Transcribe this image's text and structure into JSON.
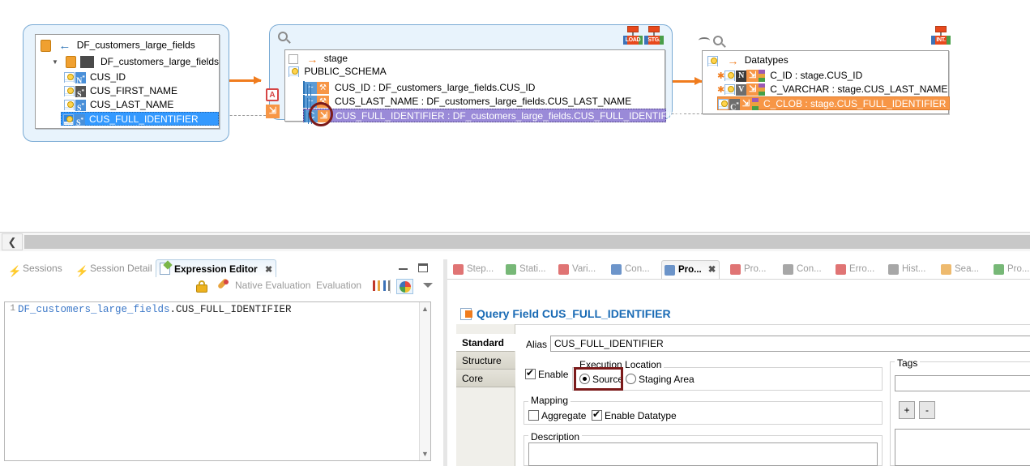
{
  "diagram": {
    "source_panel": {
      "title": "DF_customers_large_fields",
      "group_label": "DF_customers_large_fields",
      "fields": [
        {
          "name": "CUS_ID",
          "type_letter": "N",
          "selected": false
        },
        {
          "name": "CUS_FIRST_NAME",
          "type_letter": "S",
          "selected": false
        },
        {
          "name": "CUS_LAST_NAME",
          "type_letter": "S",
          "selected": false
        },
        {
          "name": "CUS_FULL_IDENTIFIER",
          "type_letter": "S",
          "selected": true
        }
      ]
    },
    "stage_panel": {
      "title": "stage",
      "schema": "PUBLIC_SCHEMA",
      "badges": [
        "LOAD",
        "STG."
      ],
      "rows": [
        {
          "text": "CUS_ID : DF_customers_large_fields.CUS_ID",
          "selected": false
        },
        {
          "text": "CUS_LAST_NAME : DF_customers_large_fields.CUS_LAST_NAME",
          "selected": false
        },
        {
          "text": "CUS_FULL_IDENTIFIER : DF_customers_large_fields.CUS_FULL_IDENTIFIER",
          "selected": true
        }
      ],
      "left_icons": [
        "A",
        "export-icon"
      ]
    },
    "datatypes_panel": {
      "title": "Datatypes",
      "badges": [
        "INT."
      ],
      "rows": [
        {
          "letter": "N",
          "text": "C_ID : stage.CUS_ID",
          "selected": false
        },
        {
          "letter": "V",
          "text": "C_VARCHAR : stage.CUS_LAST_NAME",
          "selected": false
        },
        {
          "letter": "C",
          "text": "C_CLOB : stage.CUS_FULL_IDENTIFIER",
          "selected": true
        }
      ]
    }
  },
  "expression_editor": {
    "tabs": [
      {
        "label": "Sessions",
        "active": false,
        "icon": "bolt-icon"
      },
      {
        "label": "Session Detail",
        "active": false,
        "icon": "bolt-detail-icon"
      },
      {
        "label": "Expression Editor",
        "active": true,
        "icon": "pencil-icon"
      }
    ],
    "toolbar": {
      "lock_icon": "lock-icon",
      "rocket_icon": "rocket-icon",
      "native_evaluation_label": "Native Evaluation",
      "evaluation_label": "Evaluation",
      "books_icon": "books-icon",
      "palette_icon": "color-wheel-icon",
      "menu_icon": "view-menu-icon"
    },
    "code": {
      "line_number": "1",
      "prefix": "DF_customers_large_fields",
      "suffix": ".CUS_FULL_IDENTIFIER"
    },
    "window_buttons": [
      "minimize",
      "maximize"
    ]
  },
  "properties_view": {
    "tabs": [
      {
        "label": "Step...",
        "icon": "steps-icon",
        "active": false
      },
      {
        "label": "Stati...",
        "icon": "statistics-icon",
        "active": false
      },
      {
        "label": "Vari...",
        "icon": "variables-icon",
        "active": false
      },
      {
        "label": "Con...",
        "icon": "console-icon",
        "active": false
      },
      {
        "label": "Pro...",
        "icon": "properties-icon",
        "active": true
      },
      {
        "label": "Pro...",
        "icon": "problems-icon",
        "active": false
      },
      {
        "label": "Con...",
        "icon": "connections-icon",
        "active": false
      },
      {
        "label": "Erro...",
        "icon": "error-log-icon",
        "active": false
      },
      {
        "label": "Hist...",
        "icon": "history-icon",
        "active": false
      },
      {
        "label": "Sea...",
        "icon": "search-icon",
        "active": false
      },
      {
        "label": "Pro...",
        "icon": "progress-icon",
        "active": false
      }
    ],
    "title": "Query Field CUS_FULL_IDENTIFIER",
    "title_icon": "query-field-icon",
    "side_tabs": [
      {
        "label": "Standard",
        "selected": true
      },
      {
        "label": "Structure",
        "selected": false
      },
      {
        "label": "Core",
        "selected": false
      }
    ],
    "alias": {
      "label": "Alias",
      "value": "CUS_FULL_IDENTIFIER"
    },
    "enable": {
      "label": "Enable",
      "checked": true
    },
    "execution_location": {
      "legend": "Execution Location",
      "options": [
        {
          "label": "Source",
          "selected": true
        },
        {
          "label": "Staging Area",
          "selected": false
        }
      ]
    },
    "mapping": {
      "legend": "Mapping",
      "aggregate": {
        "label": "Aggregate",
        "checked": false
      },
      "enable_datatype": {
        "label": "Enable Datatype",
        "checked": true
      }
    },
    "description": {
      "legend": "Description",
      "value": ""
    },
    "tags": {
      "legend": "Tags",
      "input_value": "",
      "add_label": "+",
      "remove_label": "-"
    }
  },
  "annotations": {
    "circle_target": "CUS_FULL_IDENTIFIER row export icon",
    "rect_target": "Source radio button",
    "color": "#7b1a1a"
  },
  "colors": {
    "selection_blue": "#3399ff",
    "selection_purple": "#9a8ad8",
    "selection_orange": "#f79646",
    "accent_orange": "#f07c1e",
    "title_blue": "#1a6bb5",
    "annotation_red": "#7b1a1a"
  }
}
